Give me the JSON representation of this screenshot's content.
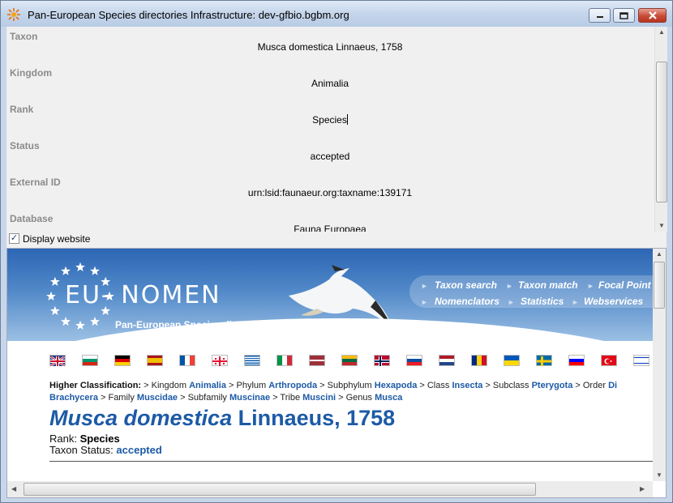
{
  "window": {
    "title": "Pan-European Species directories Infrastructure: dev-gfbio.bgbm.org"
  },
  "properties": [
    {
      "label": "Taxon",
      "value": "Musca domestica Linnaeus, 1758"
    },
    {
      "label": "Kingdom",
      "value": "Animalia"
    },
    {
      "label": "Rank",
      "value": "Species"
    },
    {
      "label": "Status",
      "value": "accepted"
    },
    {
      "label": "External ID",
      "value": "urn:lsid:faunaeur.org:taxname:139171"
    },
    {
      "label": "Database",
      "value": "Fauna Europaea"
    }
  ],
  "display_website": {
    "label": "Display website",
    "checked": true
  },
  "web": {
    "logo": "EU- NOMEN",
    "subtitle": "Pan-European Species directories Infrastructure",
    "nav": [
      "Taxon search",
      "Taxon match",
      "Focal Point",
      "Nomenclators",
      "Statistics",
      "Webservices"
    ],
    "flags": [
      "uk",
      "bg",
      "de",
      "es",
      "fr",
      "ge",
      "gr",
      "it",
      "lv",
      "lt",
      "no",
      "sk",
      "nl",
      "ro",
      "ua",
      "se",
      "si",
      "tr",
      "il"
    ],
    "classification": {
      "heading": "Higher Classification:",
      "line1": [
        {
          "rank": "Kingdom",
          "name": "Animalia"
        },
        {
          "rank": "Phylum",
          "name": "Arthropoda"
        },
        {
          "rank": "Subphylum",
          "name": "Hexapoda"
        },
        {
          "rank": "Class",
          "name": "Insecta"
        },
        {
          "rank": "Subclass",
          "name": "Pterygota"
        },
        {
          "rank": "Order",
          "name": "Di"
        }
      ],
      "line2_first": "Brachycera",
      "line2": [
        {
          "rank": "Family",
          "name": "Muscidae"
        },
        {
          "rank": "Subfamily",
          "name": "Muscinae"
        },
        {
          "rank": "Tribe",
          "name": "Muscini"
        },
        {
          "rank": "Genus",
          "name": "Musca"
        }
      ]
    },
    "species_name": "Musca domestica",
    "species_author": "Linnaeus, 1758",
    "rank_label": "Rank:",
    "rank_value": "Species",
    "status_label": "Taxon Status:",
    "status_value": "accepted"
  },
  "colors": {
    "link": "#1c5aa6",
    "banner": "#2d66b4"
  }
}
